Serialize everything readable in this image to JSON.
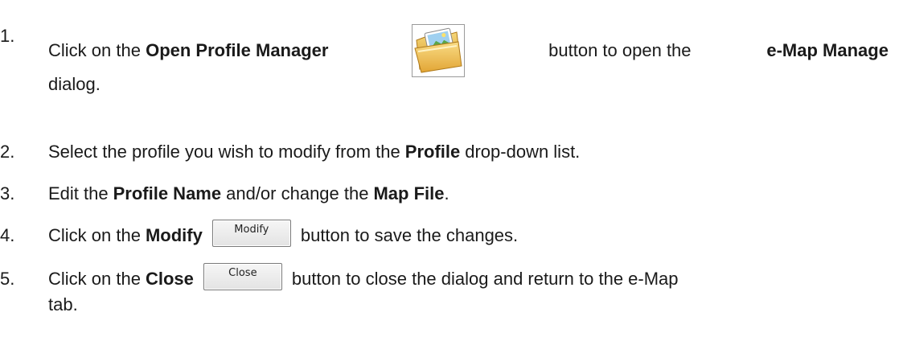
{
  "steps": [
    {
      "num": "1.",
      "line1": {
        "prefix": "Click on the",
        "bold1": "Open Profile Manager",
        "middle": "button to open the",
        "bold2": "e-Map Manage"
      },
      "line2": "dialog.",
      "icon": "folder-image-icon"
    },
    {
      "num": "2.",
      "prefix": "Select the profile you wish to modify from the",
      "bold": "Profile",
      "suffix": "drop-down list."
    },
    {
      "num": "3.",
      "prefix": "Edit the",
      "bold1": "Profile Name",
      "middle": "and/or change the",
      "bold2": "Map File",
      "suffix": "."
    },
    {
      "num": "4.",
      "prefix": "Click on the",
      "bold": "Modify",
      "button_label": "Modify",
      "suffix": "button to save the changes."
    },
    {
      "num": "5.",
      "prefix": "Click on the",
      "bold": "Close",
      "button_label": "Close",
      "suffix": "button to close the dialog and return to the e-Map",
      "line2": "tab."
    }
  ]
}
